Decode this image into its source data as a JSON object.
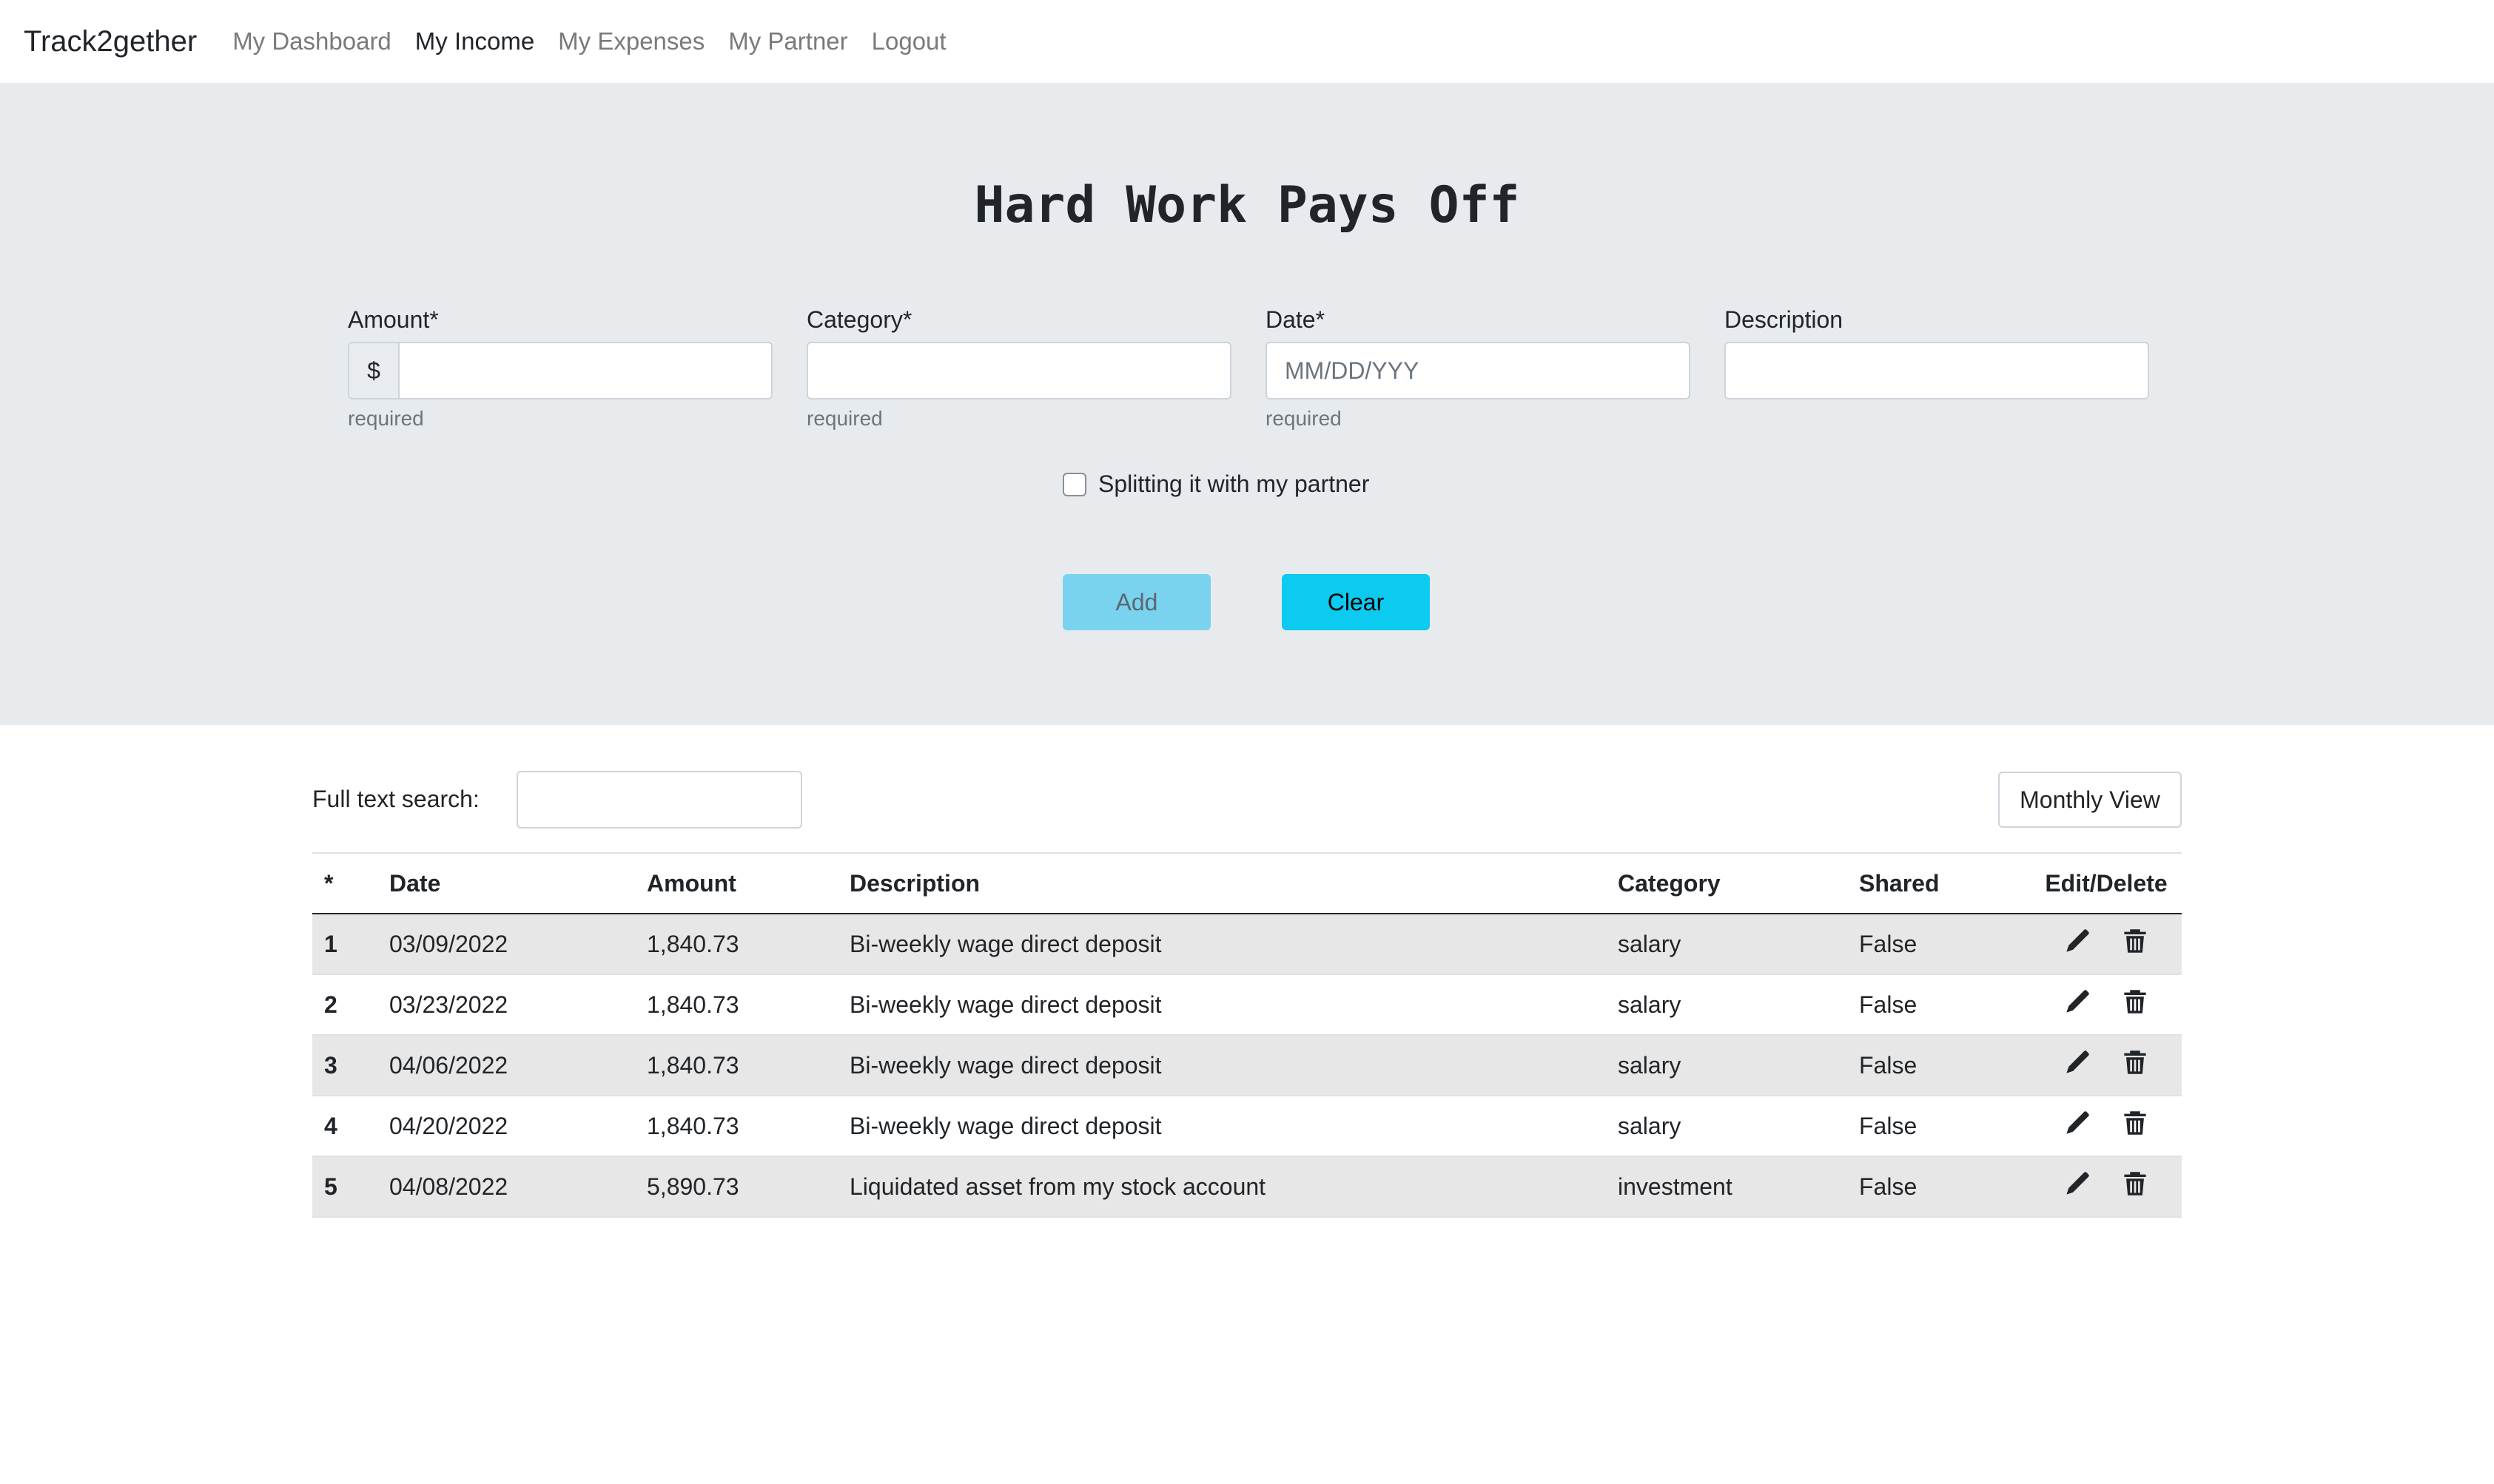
{
  "nav": {
    "brand": "Track2gether",
    "links": [
      {
        "label": "My Dashboard",
        "active": false
      },
      {
        "label": "My Income",
        "active": true
      },
      {
        "label": "My Expenses",
        "active": false
      },
      {
        "label": "My Partner",
        "active": false
      },
      {
        "label": "Logout",
        "active": false
      }
    ]
  },
  "form": {
    "title": "Hard Work Pays Off",
    "amount": {
      "label": "Amount*",
      "prefix": "$",
      "value": "",
      "help": "required"
    },
    "category": {
      "label": "Category*",
      "value": "",
      "help": "required"
    },
    "date": {
      "label": "Date*",
      "placeholder": "MM/DD/YYY",
      "value": "",
      "help": "required"
    },
    "description": {
      "label": "Description",
      "value": ""
    },
    "split_label": "Splitting it with my partner",
    "split_checked": false,
    "add_label": "Add",
    "clear_label": "Clear"
  },
  "search": {
    "label": "Full text search:",
    "value": ""
  },
  "monthly_view_label": "Monthly View",
  "table": {
    "headers": [
      "*",
      "Date",
      "Amount",
      "Description",
      "Category",
      "Shared",
      "Edit/Delete"
    ],
    "rows": [
      {
        "n": "1",
        "date": "03/09/2022",
        "amount": "1,840.73",
        "description": "Bi-weekly wage direct deposit",
        "category": "salary",
        "shared": "False"
      },
      {
        "n": "2",
        "date": "03/23/2022",
        "amount": "1,840.73",
        "description": "Bi-weekly wage direct deposit",
        "category": "salary",
        "shared": "False"
      },
      {
        "n": "3",
        "date": "04/06/2022",
        "amount": "1,840.73",
        "description": "Bi-weekly wage direct deposit",
        "category": "salary",
        "shared": "False"
      },
      {
        "n": "4",
        "date": "04/20/2022",
        "amount": "1,840.73",
        "description": "Bi-weekly wage direct deposit",
        "category": "salary",
        "shared": "False"
      },
      {
        "n": "5",
        "date": "04/08/2022",
        "amount": "5,890.73",
        "description": "Liquidated asset from my stock account",
        "category": "investment",
        "shared": "False"
      }
    ],
    "row_icons": [
      "pencil-icon",
      "trash-icon"
    ]
  },
  "colors": {
    "jumbotron_bg": "#e8ebee",
    "add_button": "#7ad3ee",
    "clear_button": "#0dcaf0",
    "striped_row": "#e7e7e7"
  }
}
